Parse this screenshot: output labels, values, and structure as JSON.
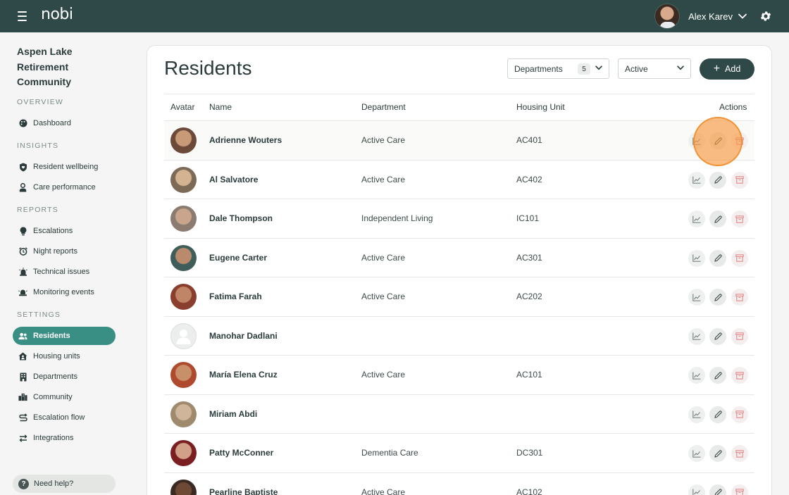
{
  "app": {
    "logo": "nobi",
    "user_name": "Alex Karev"
  },
  "sidebar": {
    "community_name": "Aspen Lake Retirement Community",
    "sections": {
      "overview": "OVERVIEW",
      "insights": "INSIGHTS",
      "reports": "REPORTS",
      "settings": "SETTINGS"
    },
    "items": {
      "dashboard": "Dashboard",
      "resident_wellbeing": "Resident wellbeing",
      "care_performance": "Care performance",
      "escalations": "Escalations",
      "night_reports": "Night reports",
      "technical_issues": "Technical issues",
      "monitoring_events": "Monitoring events",
      "residents": "Residents",
      "housing_units": "Housing units",
      "departments": "Departments",
      "community": "Community",
      "escalation_flow": "Escalation flow",
      "integrations": "Integrations"
    },
    "active_item": "residents",
    "help": "Need help?"
  },
  "main": {
    "title": "Residents",
    "departments_filter": {
      "label": "Departments",
      "count": "5"
    },
    "status_filter": {
      "value": "Active"
    },
    "add_button": "Add",
    "table": {
      "headers": {
        "avatar": "Avatar",
        "name": "Name",
        "department": "Department",
        "housing_unit": "Housing Unit",
        "actions": "Actions"
      },
      "rows": [
        {
          "name": "Adrienne Wouters",
          "department": "Active Care",
          "unit": "AC401"
        },
        {
          "name": "Al Salvatore",
          "department": "Active Care",
          "unit": "AC402"
        },
        {
          "name": "Dale Thompson",
          "department": "Independent Living",
          "unit": "IC101"
        },
        {
          "name": "Eugene Carter",
          "department": "Active Care",
          "unit": "AC301"
        },
        {
          "name": "Fatima Farah",
          "department": "Active Care",
          "unit": "AC202"
        },
        {
          "name": "Manohar Dadlani",
          "department": "",
          "unit": ""
        },
        {
          "name": "María Elena Cruz",
          "department": "Active Care",
          "unit": "AC101"
        },
        {
          "name": "Miriam Abdi",
          "department": "",
          "unit": ""
        },
        {
          "name": "Patty McConner",
          "department": "Dementia Care",
          "unit": "DC301"
        },
        {
          "name": "Pearline Baptiste",
          "department": "Active Care",
          "unit": "AC102"
        }
      ]
    }
  },
  "colors": {
    "topbar": "#2e4947",
    "accent": "#3a8f85",
    "cursor_highlight": "#f79940"
  },
  "icons": {
    "menu": "hamburger-icon",
    "settings": "gear-icon",
    "row_actions": [
      "stats-chart-icon",
      "pencil-edit-icon",
      "archive-box-icon"
    ]
  }
}
